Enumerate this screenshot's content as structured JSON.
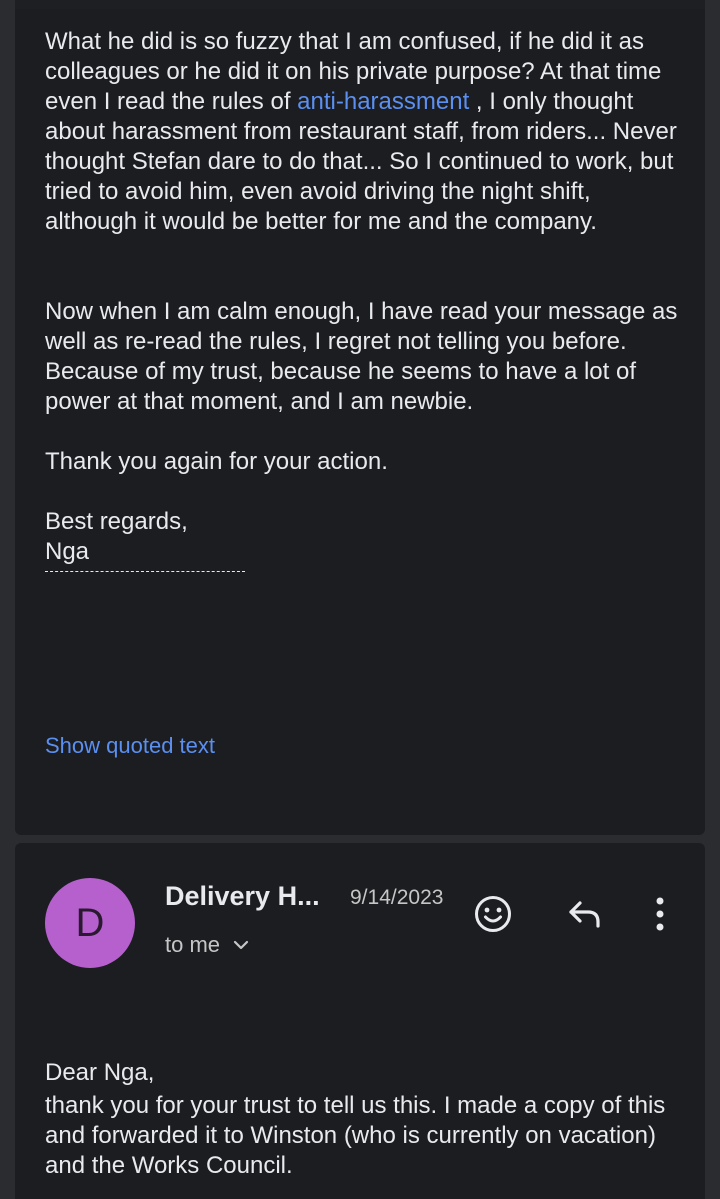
{
  "message1": {
    "para1_before_link": "What he did is so fuzzy that I am confused, if he did it as colleagues or he did it on his private purpose? At that time even I read the rules of ",
    "para1_link": "anti-harassment",
    "para1_after_link": " , I only thought about harassment from restaurant staff, from riders... Never thought Stefan dare to do that... So I continued to work, but tried to avoid him, even avoid driving the night shift, although it would be better for me and the company.",
    "para2": "Now when I am calm enough, I have read your message as well as re-read the rules, I regret not telling you before. Because of my trust, because he seems to have a lot of power at that moment, and I am newbie.",
    "para3": "Thank you again for your action.",
    "closing": "Best regards,",
    "signature": "Nga",
    "show_quoted_text": "Show quoted text"
  },
  "message2": {
    "avatar_letter": "D",
    "avatar_color": "#b660cd",
    "sender": "Delivery H...",
    "date": "9/14/2023",
    "recipients": "to me",
    "greeting": "Dear Nga,",
    "body": "thank you for your trust to tell us this. I made a copy of this and forwarded it to Winston (who is currently on vacation) and the Works Council.",
    "actions": {
      "emoji_icon": "add-reaction-icon",
      "reply_icon": "reply-icon",
      "more_icon": "more-vertical-icon"
    }
  },
  "colors": {
    "background": "#2b2c30",
    "card": "#1c1d21",
    "text": "#e8eaed",
    "secondary_text": "#c4c7c5",
    "link": "#5b8ff0"
  }
}
